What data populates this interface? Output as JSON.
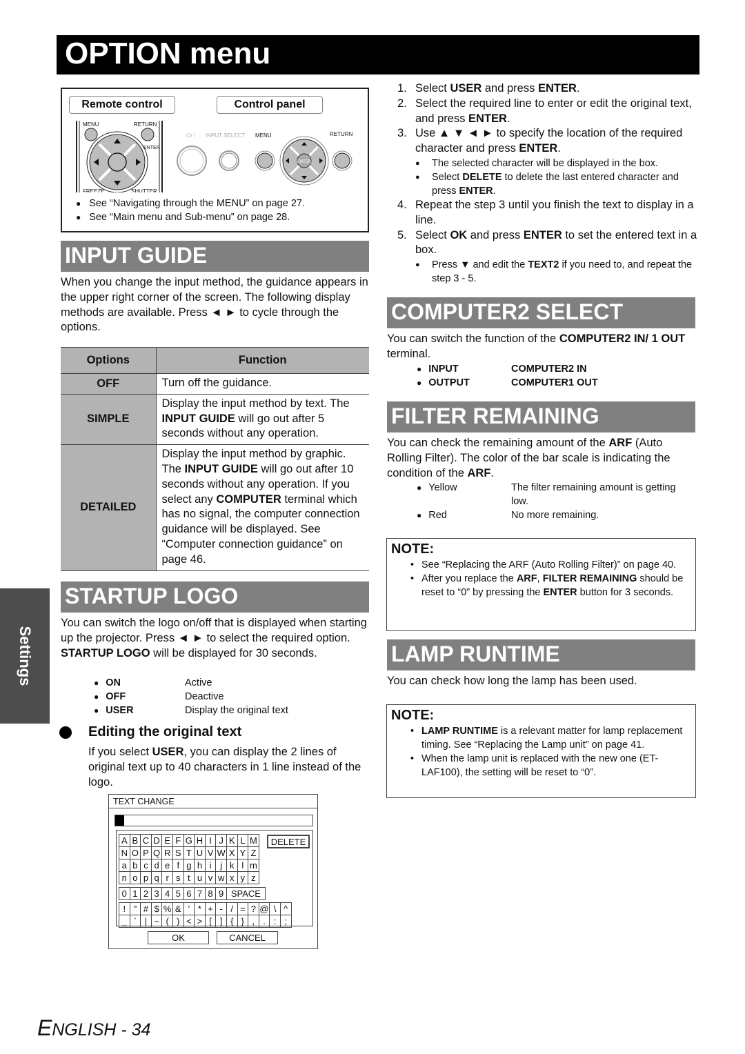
{
  "page_title": "OPTION menu",
  "side_tab": "Settings",
  "footer": {
    "prefix": "E",
    "label": "NGLISH - 34"
  },
  "nav_box": {
    "remote_label": "Remote control",
    "panel_label": "Control panel",
    "remote_buttons": {
      "menu": "MENU",
      "return": "RETURN",
      "enter": "ENTER",
      "freeze": "FREEZE",
      "shutter": "SHUTTER"
    },
    "panel_buttons": {
      "power": "⏻/ I",
      "input_select": "INPUT SELECT",
      "menu": "MENU",
      "return": "RETURN",
      "enter": "ENTER"
    },
    "notes": [
      "See “Navigating through the MENU” on page 27.",
      "See “Main menu and Sub-menu” on page 28."
    ]
  },
  "input_guide": {
    "heading": "INPUT GUIDE",
    "intro": "When you change the input method, the guidance appears in the upper right corner of the screen. The following display methods are available. Press ◄ ► to cycle through the options.",
    "table": {
      "headers": [
        "Options",
        "Function"
      ],
      "rows": [
        {
          "option": "OFF",
          "parts": [
            [
              "Turn off the guidance.",
              false
            ]
          ]
        },
        {
          "option": "SIMPLE",
          "parts": [
            [
              "Display the input method by text. The ",
              false
            ],
            [
              "INPUT GUIDE",
              true
            ],
            [
              " will go out after 5 seconds without any operation.",
              false
            ]
          ]
        },
        {
          "option": "DETAILED",
          "parts": [
            [
              "Display the input method by graphic. The ",
              false
            ],
            [
              "INPUT GUIDE",
              true
            ],
            [
              " will go out after 10 seconds without any operation. If you select any ",
              false
            ],
            [
              "COMPUTER",
              true
            ],
            [
              " terminal which has no signal, the computer connection guidance will be displayed. See “Computer connection guidance” on page 46.",
              false
            ]
          ]
        }
      ]
    }
  },
  "startup_logo": {
    "heading": "STARTUP LOGO",
    "intro_a": "You can switch the logo on/off that is displayed when starting up the projector. Press ◄ ► to select the required option. ",
    "intro_bold": "STARTUP LOGO",
    "intro_b": " will be displayed for 30 seconds.",
    "options": [
      {
        "key": "ON",
        "value": "Active"
      },
      {
        "key": "OFF",
        "value": "Deactive"
      },
      {
        "key": "USER",
        "value": "Display the original text"
      }
    ],
    "sub_heading": "Editing the original text",
    "sub_text_a": "If you select ",
    "sub_text_bold": "USER",
    "sub_text_b": ", you can display the 2 lines of original text up to 40 characters in 1 line instead of the logo."
  },
  "text_change": {
    "title": "TEXT CHANGE",
    "rows_letters": [
      [
        "A",
        "B",
        "C",
        "D",
        "E",
        "F",
        "G",
        "H",
        "I",
        "J",
        "K",
        "L",
        "M"
      ],
      [
        "N",
        "O",
        "P",
        "Q",
        "R",
        "S",
        "T",
        "U",
        "V",
        "W",
        "X",
        "Y",
        "Z"
      ],
      [
        "a",
        "b",
        "c",
        "d",
        "e",
        "f",
        "g",
        "h",
        "i",
        "j",
        "k",
        "l",
        "m"
      ],
      [
        "n",
        "o",
        "p",
        "q",
        "r",
        "s",
        "t",
        "u",
        "v",
        "w",
        "x",
        "y",
        "z"
      ]
    ],
    "rows_digits": [
      "0",
      "1",
      "2",
      "3",
      "4",
      "5",
      "6",
      "7",
      "8",
      "9",
      "SPACE"
    ],
    "rows_symbols": [
      [
        "!",
        "\"",
        "#",
        "$",
        "%",
        "&",
        "'",
        "*",
        "+",
        "-",
        "/",
        "=",
        "?",
        "@",
        "\\",
        "^"
      ],
      [
        "_",
        "`",
        "|",
        "~",
        "(",
        ")",
        "<",
        ">",
        "[",
        "]",
        "{",
        "}",
        ",",
        ".",
        ":",
        ";"
      ]
    ],
    "delete_label": "DELETE",
    "ok_label": "OK",
    "cancel_label": "CANCEL"
  },
  "steps": [
    [
      [
        "Select ",
        false
      ],
      [
        "USER",
        true
      ],
      [
        " and press ",
        false
      ],
      [
        "ENTER",
        true
      ],
      [
        ".",
        false
      ]
    ],
    [
      [
        "Select the required line to enter or edit the original text, and press ",
        false
      ],
      [
        "ENTER",
        true
      ],
      [
        ".",
        false
      ]
    ],
    [
      [
        "Use ▲ ▼ ◄ ► to specify the location of the required character and press ",
        false
      ],
      [
        "ENTER",
        true
      ],
      [
        ".",
        false
      ]
    ],
    [
      [
        "Repeat the step 3 until you finish the text to display in a line.",
        false
      ]
    ],
    [
      [
        "Select ",
        false
      ],
      [
        "OK",
        true
      ],
      [
        " and press ",
        false
      ],
      [
        "ENTER",
        true
      ],
      [
        " to set the entered text in a box.",
        false
      ]
    ]
  ],
  "step3_bullets": [
    [
      [
        "The selected character will be displayed in the box.",
        false
      ]
    ],
    [
      [
        "Select ",
        false
      ],
      [
        "DELETE",
        true
      ],
      [
        " to delete the last entered character and press ",
        false
      ],
      [
        "ENTER",
        true
      ],
      [
        ".",
        false
      ]
    ]
  ],
  "step5_bullets": [
    [
      [
        "Press ▼ and edit the ",
        false
      ],
      [
        "TEXT2",
        true
      ],
      [
        " if you need to, and repeat the step 3 - 5.",
        false
      ]
    ]
  ],
  "computer2_select": {
    "heading": "COMPUTER2 SELECT",
    "intro": [
      [
        "You can switch the function of the ",
        false
      ],
      [
        "COMPUTER2 IN/ 1 OUT",
        true
      ],
      [
        " terminal.",
        false
      ]
    ],
    "options": [
      {
        "key": "INPUT",
        "value": "COMPUTER2 IN"
      },
      {
        "key": "OUTPUT",
        "value": "COMPUTER1 OUT"
      }
    ]
  },
  "filter_remaining": {
    "heading": "FILTER REMAINING",
    "intro": [
      [
        "You can check the remaining amount of the ",
        false
      ],
      [
        "ARF",
        true
      ],
      [
        " (Auto Rolling Filter). The color of the bar scale is indicating the condition of the ",
        false
      ],
      [
        "ARF",
        true
      ],
      [
        ".",
        false
      ]
    ],
    "options": [
      {
        "key": "Yellow",
        "value": "The filter remaining amount is getting low."
      },
      {
        "key": "Red",
        "value": "No more remaining."
      }
    ],
    "note_title": "NOTE:",
    "notes": [
      [
        [
          "See “Replacing the ARF (Auto Rolling Filter)” on page 40.",
          false
        ]
      ],
      [
        [
          "After you replace the ",
          false
        ],
        [
          "ARF",
          true
        ],
        [
          ", ",
          false
        ],
        [
          "FILTER REMAINING",
          true
        ],
        [
          " should be reset to “0” by pressing the ",
          false
        ],
        [
          "ENTER",
          true
        ],
        [
          " button for 3 seconds.",
          false
        ]
      ]
    ]
  },
  "lamp_runtime": {
    "heading": "LAMP RUNTIME",
    "intro": "You can check how long the lamp has been used.",
    "note_title": "NOTE:",
    "notes": [
      [
        [
          "LAMP RUNTIME",
          true
        ],
        [
          " is a relevant matter for lamp replacement timing. See “Replacing the Lamp unit” on page 41.",
          false
        ]
      ],
      [
        [
          "When the lamp unit is replaced with the new one (ET-LAF100), the setting will be reset to “0”.",
          false
        ]
      ]
    ]
  }
}
